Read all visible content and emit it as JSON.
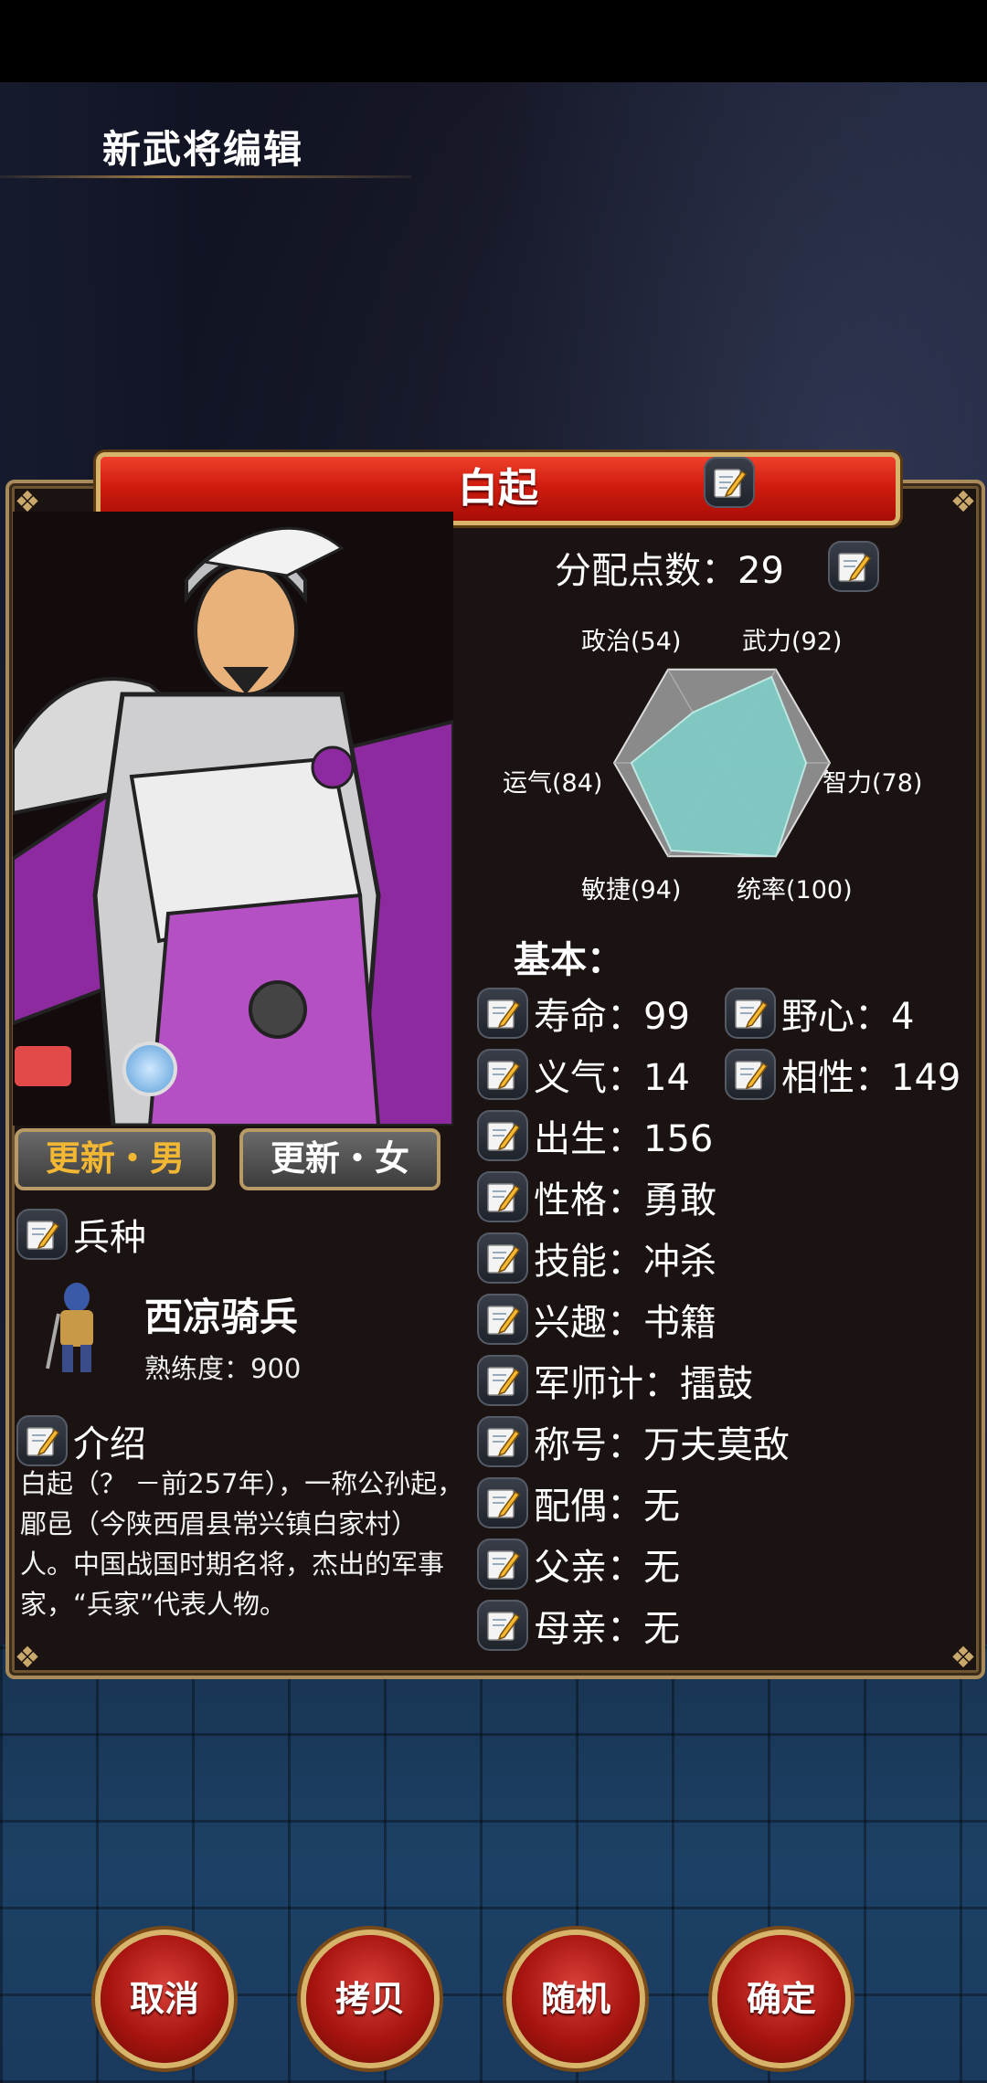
{
  "page": {
    "title": "新武将编辑"
  },
  "general": {
    "name": "白起"
  },
  "gender_buttons": {
    "male": "更新・男",
    "female": "更新・女"
  },
  "unit": {
    "section_label": "兵种",
    "name": "西凉骑兵",
    "proficiency": "熟练度：900"
  },
  "intro": {
    "section_label": "介绍",
    "text": "白起（？ －前257年），一称公孙起，郿邑（今陕西眉县常兴镇白家村）人。中国战国时期名将，杰出的军事家，“兵家”代表人物。"
  },
  "points": {
    "label": "分配点数：",
    "value": "29"
  },
  "radar": {
    "labels": {
      "politics": "政治(54)",
      "force": "武力(92)",
      "intellect": "智力(78)",
      "command": "统率(100)",
      "agility": "敏捷(94)",
      "luck": "运气(84)"
    },
    "values": {
      "politics": 54,
      "force": 92,
      "intellect": 78,
      "command": 100,
      "agility": 94,
      "luck": 84
    },
    "max": 100,
    "fill_color": "#7ecac3",
    "bg_color": "#8a8a8a"
  },
  "basic": {
    "label": "基本：",
    "lifespan": "寿命：99",
    "ambition": "野心：4",
    "loyalty": "义气：14",
    "compat": "相性：149",
    "birth": "出生：156",
    "personality": "性格：勇敢",
    "skill": "技能：冲杀",
    "hobby": "兴趣：书籍",
    "strategy": "军师计：擂鼓",
    "honor": "称号：万夫莫敌",
    "spouse": "配偶：无",
    "father": "父亲：无",
    "mother": "母亲：无"
  },
  "footer": {
    "cancel": "取消",
    "copy": "拷贝",
    "random": "随机",
    "confirm": "确定"
  },
  "colors": {
    "banner_red": "#d01d10",
    "gold_border": "#d8b46a",
    "male_text": "#f2b733"
  }
}
